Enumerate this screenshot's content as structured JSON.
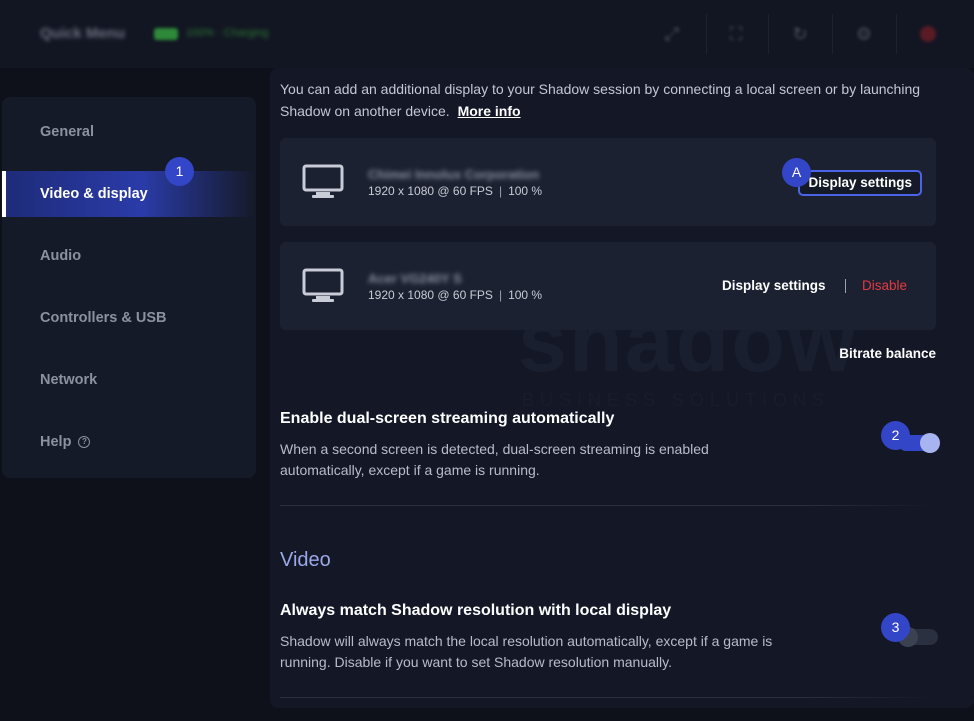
{
  "topbar": {
    "title": "Quick Menu",
    "battery_text": "100% · Charging",
    "icons": [
      "resize-icon",
      "screenshot-icon",
      "refresh-icon",
      "settings-icon",
      "power-icon"
    ]
  },
  "sidebar": {
    "items": [
      {
        "label": "General"
      },
      {
        "label": "Video & display"
      },
      {
        "label": "Audio"
      },
      {
        "label": "Controllers & USB"
      },
      {
        "label": "Network"
      },
      {
        "label": "Help"
      }
    ]
  },
  "badges": {
    "one": "1",
    "a": "A",
    "two": "2",
    "three": "3"
  },
  "intro": {
    "text": "You can add an additional display to your Shadow session by connecting a local screen or by launching Shadow on another device.",
    "link": "More info"
  },
  "displays": [
    {
      "name": "Chimei Innolux Corporation",
      "resolution": "1920 x 1080 @ 60 FPS",
      "scale": "100 %",
      "settings_label": "Display settings"
    },
    {
      "name": "Acer VG240Y S",
      "resolution": "1920 x 1080 @ 60 FPS",
      "scale": "100 %",
      "settings_label": "Display settings",
      "disable_label": "Disable"
    }
  ],
  "bitrate_label": "Bitrate balance",
  "watermark": {
    "text": "shadow",
    "sub": "BUSINESS SOLUTIONS"
  },
  "settings": {
    "dual_screen": {
      "title": "Enable dual-screen streaming automatically",
      "desc": "When a second screen is detected, dual-screen streaming is enabled automatically, except if a game is running.",
      "enabled": true
    },
    "video_heading": "Video",
    "match_resolution": {
      "title": "Always match Shadow resolution with local display",
      "desc": "Shadow will always match the local resolution automatically, except if a game is running. Disable if you want to set Shadow resolution manually.",
      "enabled": false
    }
  },
  "colors": {
    "accent": "#3346c8",
    "danger": "#e23a42",
    "section": "#9aa8e8"
  }
}
